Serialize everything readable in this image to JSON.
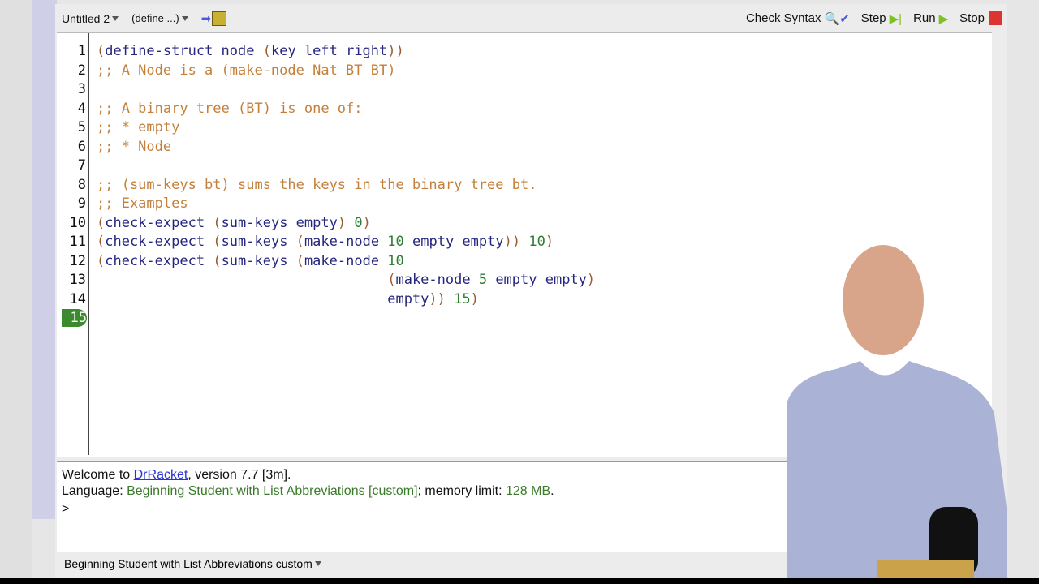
{
  "toolbar": {
    "file_name": "Untitled 2",
    "define_menu": "(define ...)",
    "check_syntax": "Check Syntax",
    "step": "Step",
    "run": "Run",
    "stop": "Stop"
  },
  "colors": {
    "paren": "#9b5b2e",
    "identifier": "#262680",
    "comment": "#c4803a",
    "number": "#2e7d32",
    "current_line": "#3c8a2e",
    "stop": "#d33"
  },
  "editor": {
    "current_line": "15",
    "lines": [
      {
        "num": "1",
        "tokens": [
          [
            "(",
            "p"
          ],
          [
            "define-struct node ",
            "i"
          ],
          [
            "(",
            "p"
          ],
          [
            "key left right",
            "i"
          ],
          [
            "))",
            "p"
          ]
        ]
      },
      {
        "num": "2",
        "tokens": [
          [
            ";; A Node is a (make-node Nat BT BT)",
            "c"
          ]
        ]
      },
      {
        "num": "3",
        "tokens": []
      },
      {
        "num": "4",
        "tokens": [
          [
            ";; A binary tree (BT) is one of:",
            "c"
          ]
        ]
      },
      {
        "num": "5",
        "tokens": [
          [
            ";; * empty",
            "c"
          ]
        ]
      },
      {
        "num": "6",
        "tokens": [
          [
            ";; * Node",
            "c"
          ]
        ]
      },
      {
        "num": "7",
        "tokens": []
      },
      {
        "num": "8",
        "tokens": [
          [
            ";; (sum-keys bt) sums the keys in the binary tree bt.",
            "c"
          ]
        ]
      },
      {
        "num": "9",
        "tokens": [
          [
            ";; Examples",
            "c"
          ]
        ]
      },
      {
        "num": "10",
        "tokens": [
          [
            "(",
            "p"
          ],
          [
            "check-expect ",
            "i"
          ],
          [
            "(",
            "p"
          ],
          [
            "sum-keys empty",
            "i"
          ],
          [
            ")",
            "p"
          ],
          [
            " ",
            ""
          ],
          [
            "0",
            "n"
          ],
          [
            ")",
            "p"
          ]
        ]
      },
      {
        "num": "11",
        "tokens": [
          [
            "(",
            "p"
          ],
          [
            "check-expect ",
            "i"
          ],
          [
            "(",
            "p"
          ],
          [
            "sum-keys ",
            "i"
          ],
          [
            "(",
            "p"
          ],
          [
            "make-node ",
            "i"
          ],
          [
            "10",
            "n"
          ],
          [
            " empty empty",
            "i"
          ],
          [
            "))",
            "p"
          ],
          [
            " ",
            ""
          ],
          [
            "10",
            "n"
          ],
          [
            ")",
            "p"
          ]
        ]
      },
      {
        "num": "12",
        "tokens": [
          [
            "(",
            "p"
          ],
          [
            "check-expect ",
            "i"
          ],
          [
            "(",
            "p"
          ],
          [
            "sum-keys ",
            "i"
          ],
          [
            "(",
            "p"
          ],
          [
            "make-node ",
            "i"
          ],
          [
            "10",
            "n"
          ]
        ]
      },
      {
        "num": "13",
        "tokens": [
          [
            "                                   (",
            "p"
          ],
          [
            "make-node ",
            "i"
          ],
          [
            "5",
            "n"
          ],
          [
            " empty empty",
            "i"
          ],
          [
            ")",
            "p"
          ]
        ]
      },
      {
        "num": "14",
        "tokens": [
          [
            "                                   ",
            ""
          ],
          [
            "empty",
            "i"
          ],
          [
            "))",
            "p"
          ],
          [
            " ",
            ""
          ],
          [
            "15",
            "n"
          ],
          [
            ")",
            "p"
          ]
        ]
      },
      {
        "num": "15",
        "tokens": []
      }
    ]
  },
  "interactions": {
    "welcome_prefix": "Welcome to ",
    "welcome_link": "DrRacket",
    "welcome_suffix": ", version 7.7 [3m].",
    "language_label": "Language: ",
    "language_name": "Beginning Student with List Abbreviations [custom]",
    "memory_label": "; memory limit: ",
    "memory_value": "128 MB",
    "memory_end": ".",
    "prompt": ">"
  },
  "status": {
    "language_menu": "Beginning Student with List Abbreviations custom"
  }
}
